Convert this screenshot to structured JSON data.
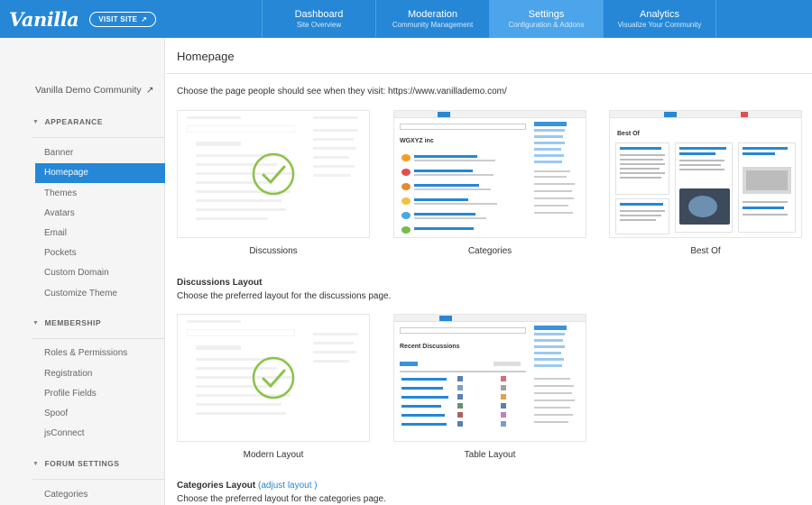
{
  "header": {
    "logo": "Vanilla",
    "visit_site": "VISIT SITE",
    "nav": [
      {
        "title": "Dashboard",
        "subtitle": "Site Overview",
        "active": false
      },
      {
        "title": "Moderation",
        "subtitle": "Community Management",
        "active": false
      },
      {
        "title": "Settings",
        "subtitle": "Configuration & Addons",
        "active": true
      },
      {
        "title": "Analytics",
        "subtitle": "Visualize Your Community",
        "active": false
      }
    ]
  },
  "sidebar": {
    "community_link": "Vanilla Demo Community",
    "appearance": {
      "title": "APPEARANCE",
      "items": [
        "Banner",
        "Homepage",
        "Themes",
        "Avatars",
        "Email",
        "Pockets",
        "Custom Domain",
        "Customize Theme"
      ],
      "active": "Homepage"
    },
    "membership": {
      "title": "MEMBERSHIP",
      "items": [
        "Roles & Permissions",
        "Registration",
        "Profile Fields",
        "Spoof",
        "jsConnect"
      ]
    },
    "forum_settings": {
      "title": "FORUM SETTINGS",
      "items": [
        "Categories"
      ]
    }
  },
  "main": {
    "title": "Homepage",
    "choose_text": "Choose the page people should see when they visit: https://www.vanillademo.com/",
    "homepage_options": [
      {
        "label": "Discussions",
        "selected": true
      },
      {
        "label": "Categories",
        "selected": false
      },
      {
        "label": "Best Of",
        "selected": false
      }
    ],
    "discussions_layout": {
      "title": "Discussions Layout",
      "description": "Choose the preferred layout for the discussions page.",
      "options": [
        {
          "label": "Modern Layout",
          "selected": true
        },
        {
          "label": "Table Layout",
          "selected": false
        }
      ]
    },
    "categories_layout": {
      "title": "Categories Layout",
      "adjust_link": "(adjust layout )",
      "description": "Choose the preferred layout for the categories page."
    },
    "mock": {
      "wgxyz": "WGXYZ inc",
      "recent_discussions": "Recent Discussions",
      "best_of": "Best Of"
    }
  },
  "colors": {
    "topbar": "#2587d6",
    "active_nav": "#4ca4ea",
    "sidebar_bg": "#f5f5f5",
    "check_green": "#8bc34a",
    "link": "#2587d6"
  }
}
